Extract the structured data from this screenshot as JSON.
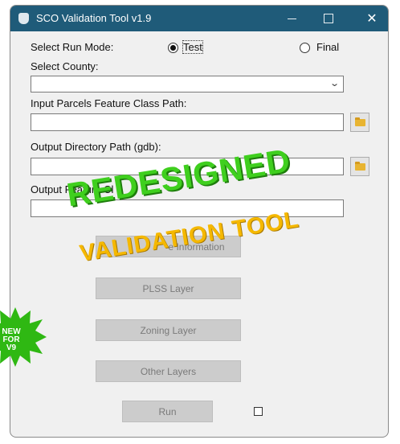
{
  "window": {
    "title": "SCO Validation Tool v1.9"
  },
  "run_mode": {
    "label": "Select Run Mode:",
    "options": [
      "Test",
      "Final"
    ],
    "selected": "Test"
  },
  "county": {
    "label": "Select County:",
    "value": ""
  },
  "parcels": {
    "label": "Input Parcels Feature Class Path:",
    "value": ""
  },
  "output_dir": {
    "label": "Output Directory Path (gdb):",
    "value": ""
  },
  "output_fc": {
    "label": "Output Feature Cl",
    "value": ""
  },
  "buttons": {
    "county_info": "e Information",
    "plss": "PLSS Layer",
    "zoning": "Zoning Layer",
    "other": "Other Layers",
    "run": "Run"
  },
  "overlay": {
    "headline": "REDESIGNED",
    "subline": "VALIDATION TOOL",
    "badge": [
      "NEW",
      "FOR",
      "V9"
    ]
  },
  "colors": {
    "titlebar": "#1f5b79",
    "headline": "#3fcf1e",
    "subline": "#f5b800",
    "badge": "#2fb813"
  }
}
